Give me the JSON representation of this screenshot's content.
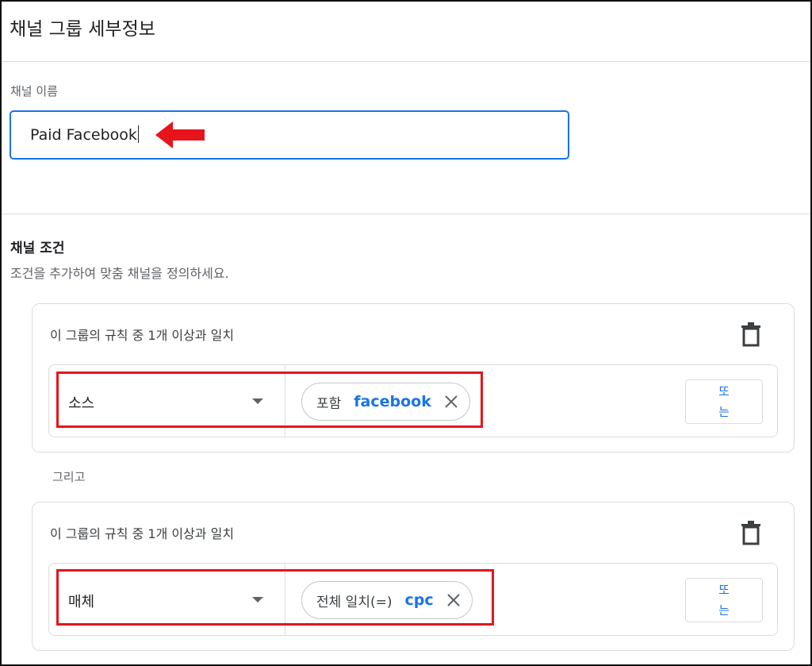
{
  "header": {
    "title": "채널 그룹 세부정보"
  },
  "channel_name": {
    "label": "채널 이름",
    "value": "Paid Facebook"
  },
  "conditions": {
    "title": "채널 조건",
    "description": "조건을 추가하여 맞춤 채널을 정의하세요.",
    "connector_label": "그리고",
    "groups": [
      {
        "heading": "이 그룹의 규칙 중 1개 이상과 일치",
        "rule": {
          "dimension": "소스",
          "operator": "포함",
          "value": "facebook",
          "or_label": "또는"
        }
      },
      {
        "heading": "이 그룹의 규칙 중 1개 이상과 일치",
        "rule": {
          "dimension": "매체",
          "operator": "전체 일치(=)",
          "value": "cpc",
          "or_label": "또는"
        }
      }
    ]
  },
  "icons": {
    "delete": "trash-icon",
    "remove": "close-icon",
    "dropdown": "chevron-down-icon",
    "annotation": "red-arrow-icon"
  },
  "colors": {
    "accent": "#1a73e8",
    "annotation": "#e8141c",
    "border": "#dadce0"
  }
}
